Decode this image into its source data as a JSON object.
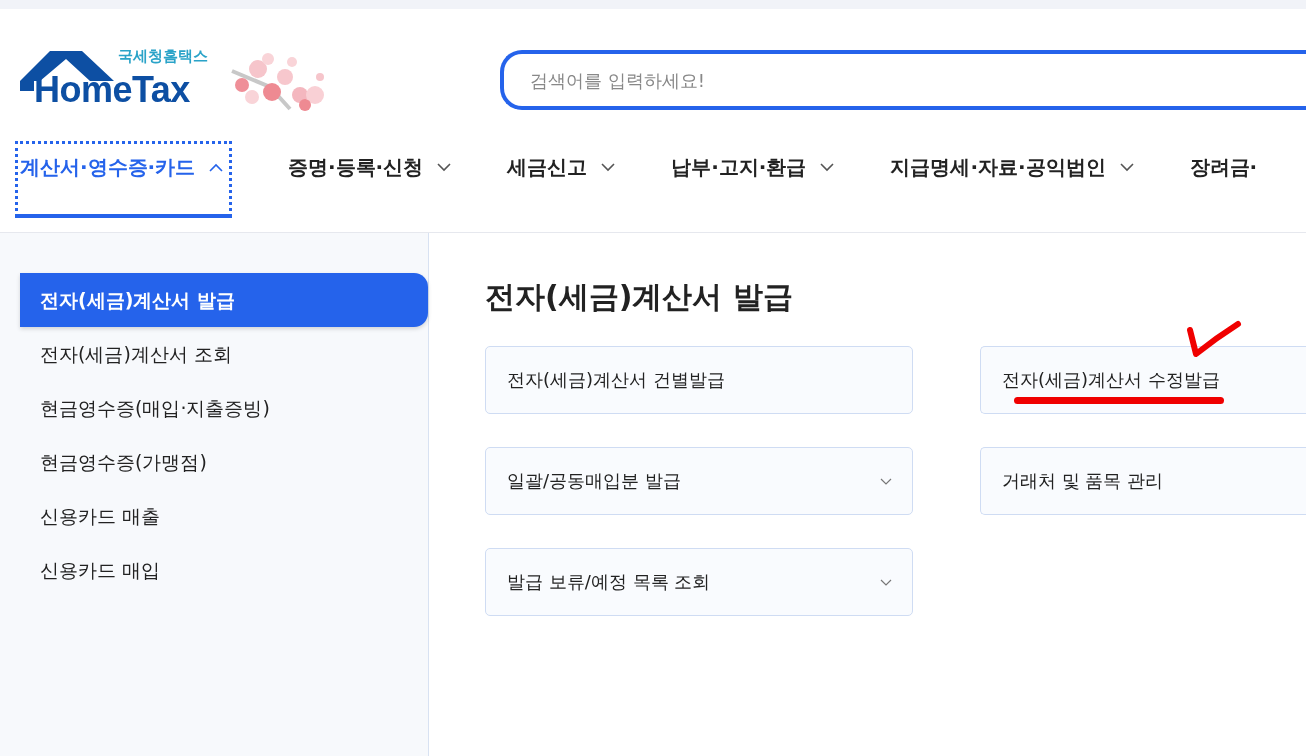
{
  "logo": {
    "subtitle": "국세청홈택스",
    "title": "HomeTax"
  },
  "search": {
    "placeholder": "검색어를 입력하세요!"
  },
  "nav": [
    {
      "label": "계산서·영수증·카드",
      "selected": true,
      "expanded": true
    },
    {
      "label": "증명·등록·신청",
      "selected": false,
      "expanded": false
    },
    {
      "label": "세금신고",
      "selected": false,
      "expanded": false
    },
    {
      "label": "납부·고지·환급",
      "selected": false,
      "expanded": false
    },
    {
      "label": "지급명세·자료·공익법인",
      "selected": false,
      "expanded": false
    },
    {
      "label": "장려금·",
      "selected": false
    }
  ],
  "sidebar": {
    "items": [
      {
        "label": "전자(세금)계산서 발급",
        "selected": true
      },
      {
        "label": "전자(세금)계산서 조회",
        "selected": false
      },
      {
        "label": "현금영수증(매입·지출증빙)",
        "selected": false
      },
      {
        "label": "현금영수증(가맹점)",
        "selected": false
      },
      {
        "label": "신용카드 매출",
        "selected": false
      },
      {
        "label": "신용카드 매입",
        "selected": false
      }
    ]
  },
  "content": {
    "title": "전자(세금)계산서 발급",
    "cards": [
      {
        "label": "전자(세금)계산서 건별발급",
        "has_submenu": false,
        "marked": false
      },
      {
        "label": "전자(세금)계산서 수정발급",
        "has_submenu": false,
        "marked": true
      },
      {
        "label": "일괄/공동매입분 발급",
        "has_submenu": true,
        "marked": false
      },
      {
        "label": "거래처 및 품목 관리",
        "has_submenu": false,
        "marked": false
      },
      {
        "label": "발급 보류/예정 목록 조회",
        "has_submenu": true,
        "marked": false
      }
    ]
  }
}
